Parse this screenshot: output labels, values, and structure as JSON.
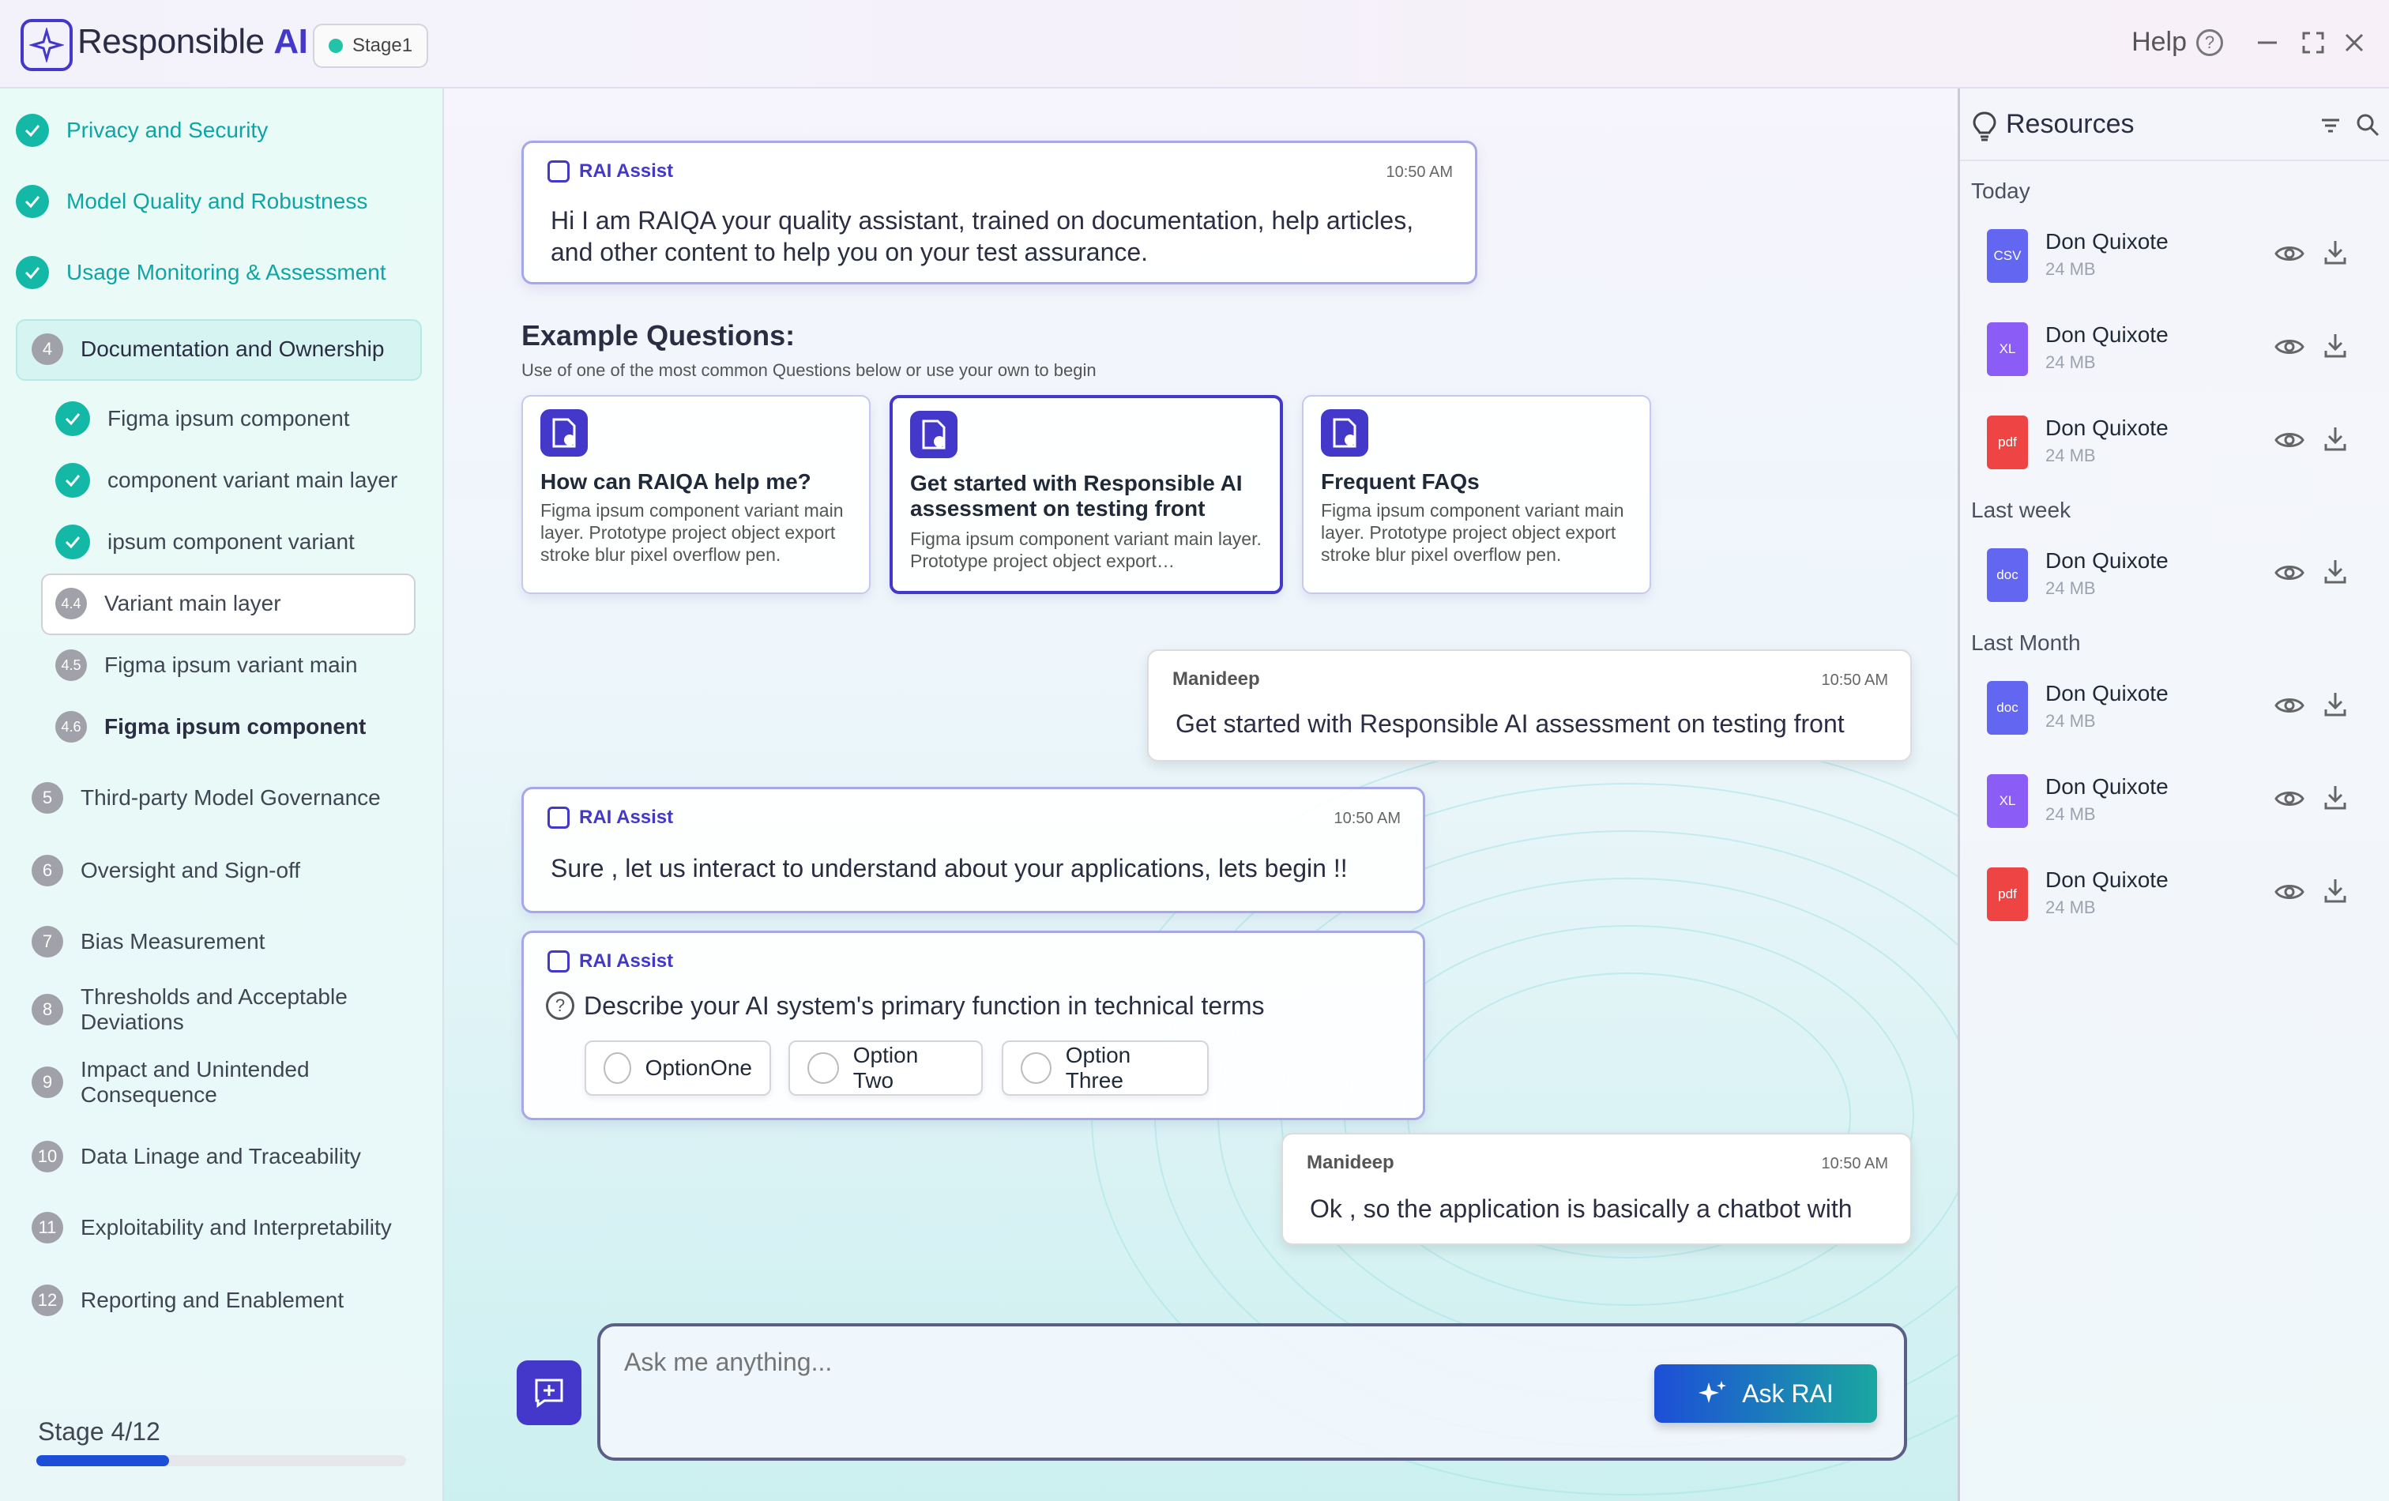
{
  "app": {
    "title_a": "Responsible ",
    "title_b": "AI",
    "stage_chip": "Stage1",
    "help": "Help"
  },
  "sidebar": {
    "sections": [
      {
        "label": "Privacy and Security",
        "status": "done"
      },
      {
        "label": "Model  Quality and Robustness",
        "status": "done"
      },
      {
        "label": "Usage Monitoring & Assessment",
        "status": "done"
      },
      {
        "num": "4",
        "label": "Documentation and Ownership",
        "status": "active"
      },
      {
        "num": "5",
        "label": "Third-party Model Governance"
      },
      {
        "num": "6",
        "label": "Oversight and Sign-off"
      },
      {
        "num": "7",
        "label": "Bias Measurement"
      },
      {
        "num": "8",
        "label": "Thresholds and Acceptable Deviations"
      },
      {
        "num": "9",
        "label": "Impact and Unintended Consequence"
      },
      {
        "num": "10",
        "label": "Data Linage and Traceability"
      },
      {
        "num": "11",
        "label": "Exploitability and Interpretability"
      },
      {
        "num": "12",
        "label": "Reporting and Enablement"
      }
    ],
    "subitems": [
      {
        "label": "Figma ipsum component",
        "status": "done"
      },
      {
        "label": "component variant main layer",
        "status": "done"
      },
      {
        "label": "ipsum component variant",
        "status": "done"
      },
      {
        "num": "4.4",
        "label": "Variant main layer",
        "status": "active"
      },
      {
        "num": "4.5",
        "label": "Figma ipsum  variant main"
      },
      {
        "num": "4.6",
        "label": "Figma ipsum component"
      }
    ],
    "stage_label": "Stage 4/12",
    "progress": 0.36
  },
  "chat": {
    "intro": {
      "sender": "RAI Assist",
      "time": "10:50 AM",
      "line1": "Hi I am RAIQA your quality assistant, trained on documentation, help articles,",
      "line2": "and other content to help you on your test assurance."
    },
    "example_title": "Example Questions:",
    "example_sub": "Use of one of the most common Questions below or use your own to begin",
    "questions": [
      {
        "title": "How can RAIQA help me?",
        "desc": "Figma ipsum component variant main layer. Prototype project object export stroke blur pixel overflow pen."
      },
      {
        "title": "Get started with Responsible AI assessment on testing front",
        "desc": "Figma ipsum component variant main layer. Prototype project object export…"
      },
      {
        "title": "Frequent FAQs",
        "desc": "Figma ipsum component variant main layer. Prototype project object export stroke blur pixel overflow pen."
      }
    ],
    "user1": {
      "sender": "Manideep",
      "time": "10:50 AM",
      "text": "Get started with Responsible AI assessment on testing front"
    },
    "bot2": {
      "sender": "RAI Assist",
      "time": "10:50 AM",
      "text": "Sure , let us interact to understand about your applications, lets begin !!"
    },
    "bot3": {
      "sender": "RAI Assist",
      "question": "Describe your AI system's primary function in technical terms",
      "options": [
        "OptionOne",
        "Option Two",
        "Option Three"
      ]
    },
    "user2": {
      "sender": "Manideep",
      "time": "10:50 AM",
      "text": "Ok , so the application is basically a chatbot with"
    },
    "input_placeholder": "Ask me anything...",
    "ask_label": "Ask RAI"
  },
  "resources": {
    "title": "Resources",
    "groups": [
      {
        "label": "Today",
        "files": [
          {
            "name": "Don Quixote",
            "size": "24 MB",
            "type": "CSV",
            "color": "#6366f1"
          },
          {
            "name": "Don Quixote",
            "size": "24 MB",
            "type": "XL",
            "color": "#8b5cf6"
          },
          {
            "name": "Don Quixote",
            "size": "24 MB",
            "type": "pdf",
            "color": "#ef4444"
          }
        ]
      },
      {
        "label": "Last week",
        "files": [
          {
            "name": "Don Quixote",
            "size": "24 MB",
            "type": "doc",
            "color": "#6366f1"
          }
        ]
      },
      {
        "label": "Last Month",
        "files": [
          {
            "name": "Don Quixote",
            "size": "24 MB",
            "type": "doc",
            "color": "#6366f1"
          },
          {
            "name": "Don Quixote",
            "size": "24 MB",
            "type": "XL",
            "color": "#8b5cf6"
          },
          {
            "name": "Don Quixote",
            "size": "24 MB",
            "type": "pdf",
            "color": "#ef4444"
          }
        ]
      }
    ]
  }
}
